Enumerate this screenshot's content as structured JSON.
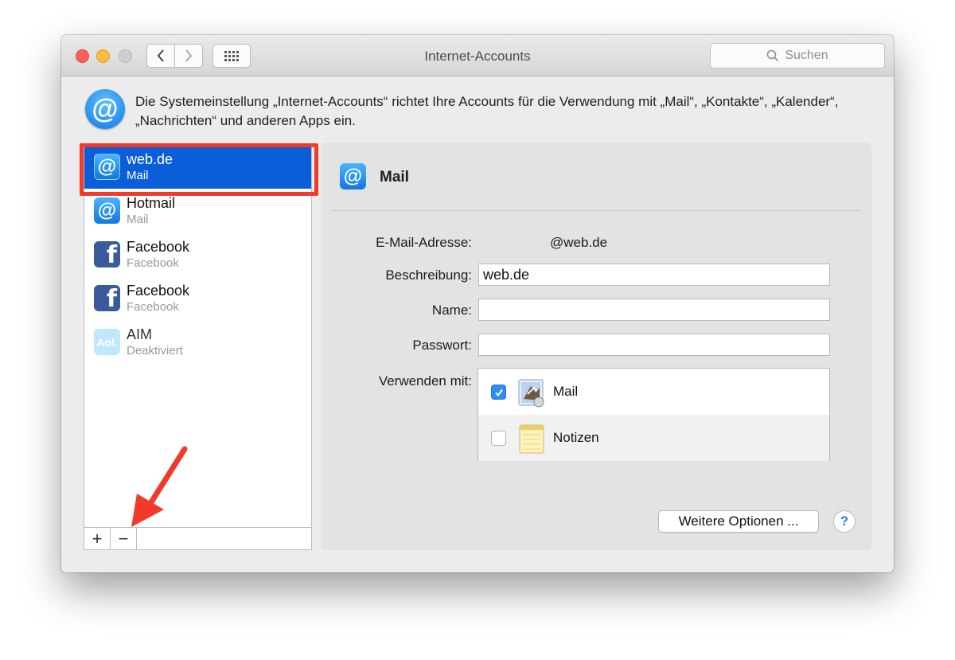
{
  "window": {
    "title": "Internet-Accounts",
    "search_placeholder": "Suchen"
  },
  "info": {
    "icon_glyph": "@",
    "text": "Die Systemeinstellung „Internet-Accounts“ richtet Ihre Accounts für die Verwendung mit „Mail“, „Kontakte“, „Kalender“, „Nachrichten“ und anderen Apps ein."
  },
  "accounts": [
    {
      "name": "web.de",
      "type": "Mail",
      "icon": "at-icon",
      "selected": true
    },
    {
      "name": "Hotmail",
      "type": "Mail",
      "icon": "at-icon"
    },
    {
      "name": "Facebook",
      "type": "Facebook",
      "icon": "facebook-icon"
    },
    {
      "name": "Facebook",
      "type": "Facebook",
      "icon": "facebook-icon"
    },
    {
      "name": "AIM",
      "type": "Deaktiviert",
      "icon": "aol-icon"
    }
  ],
  "icon_glyphs": {
    "at": "@",
    "fb": "f",
    "aol": "Aol."
  },
  "sidebar_footer": {
    "add": "+",
    "remove": "−"
  },
  "detail": {
    "title": "Mail",
    "email_label": "E-Mail-Adresse:",
    "email_value": "@web.de",
    "description_label": "Beschreibung:",
    "description_value": "web.de",
    "name_label": "Name:",
    "name_value": "",
    "password_label": "Passwort:",
    "password_value": "",
    "use_with_label": "Verwenden mit:",
    "apps": [
      {
        "name": "Mail",
        "checked": true
      },
      {
        "name": "Notizen",
        "checked": false
      }
    ],
    "more_options": "Weitere Optionen ...",
    "help": "?"
  },
  "colors": {
    "selection": "#0a5fd8",
    "highlight_annotation": "#f23a28",
    "close": "#fc605c",
    "minimize": "#fdbc40",
    "checkbox_on": "#2f8bf5"
  }
}
